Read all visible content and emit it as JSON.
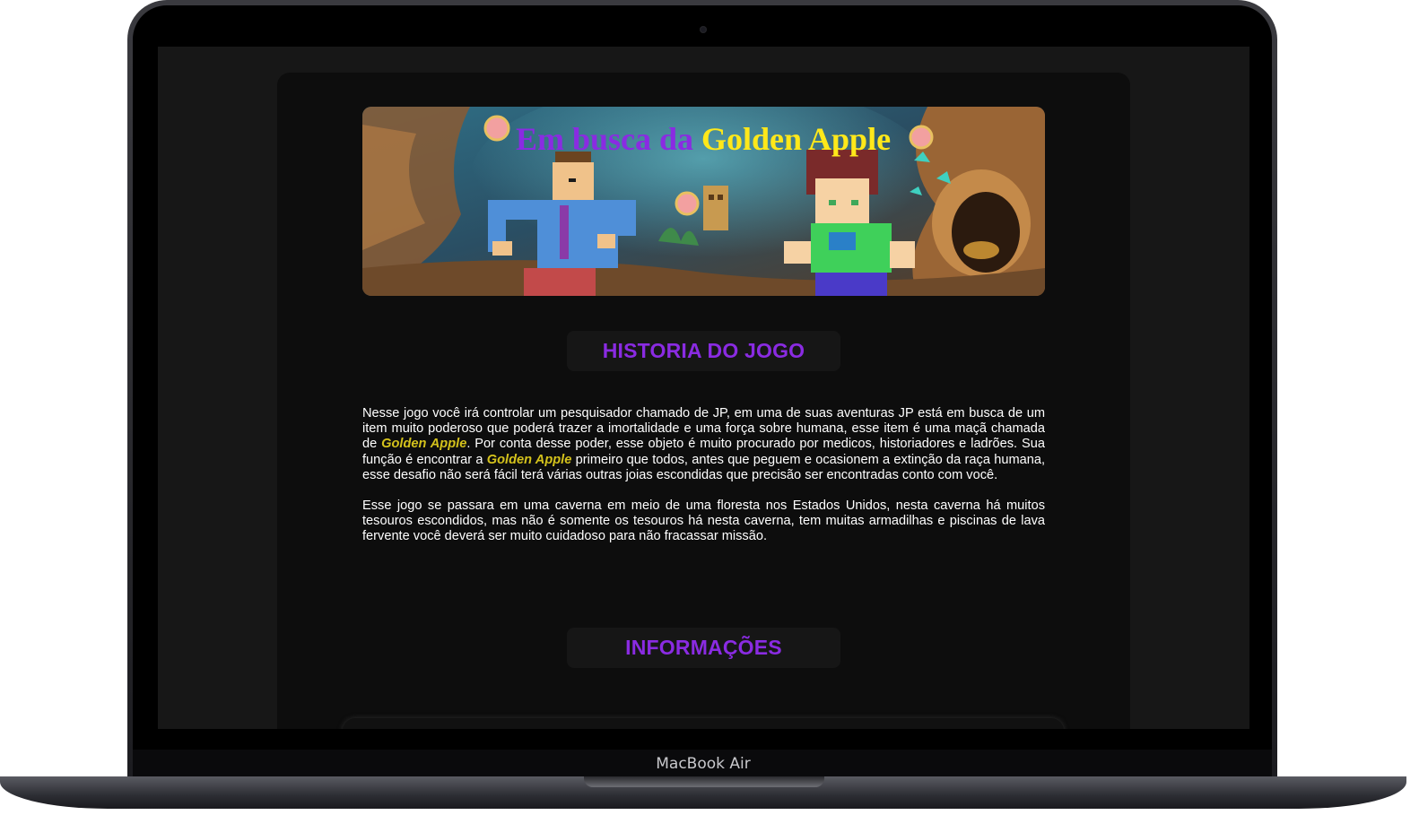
{
  "banner": {
    "title_part1": "Em busca da ",
    "title_part2": "Golden Apple",
    "alt": "Em busca da Golden Apple"
  },
  "sections": {
    "history_title": "HISTORIA DO JOGO",
    "info_title": "INFORMAÇÕES"
  },
  "story": {
    "p1_a": "Nesse jogo você irá controlar um pesquisador chamado de JP, em uma de suas aventuras JP está em busca de um item muito poderoso que poderá trazer a imortalidade e uma força sobre humana, esse item é uma maçã chamada de ",
    "golden_1": "Golden Apple",
    "p1_b": ". Por conta desse poder, esse objeto é muito procurado por medicos, historiadores e ladrões. Sua função é encontrar a ",
    "golden_2": "Golden Apple",
    "p1_c": " primeiro que todos, antes que peguem e ocasionem a extinção da raça humana, esse desafio não será fácil terá várias outras joias escondidas que precisão ser encontradas conto com você.",
    "p2": "Esse jogo se passara em uma caverna em meio de uma floresta nos Estados Unidos, nesta caverna há muitos tesouros escondidos, mas não é somente os tesouros há nesta caverna, tem muitas armadilhas e piscinas de lava fervente você deverá ser muito cuidadoso para não fracassar missão."
  },
  "device": {
    "brand_label": "MacBook Air"
  },
  "colors": {
    "accent": "#8a2be2",
    "golden": "#d4c21c",
    "page_bg": "#0d0d0d",
    "screen_bg": "#171717"
  }
}
